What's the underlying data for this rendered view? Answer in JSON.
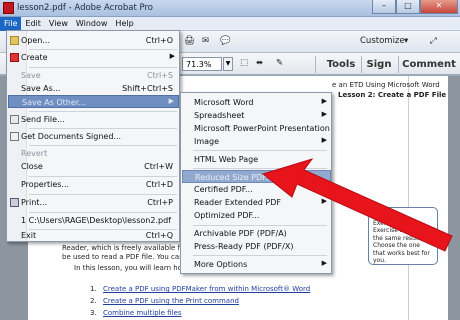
{
  "window": {
    "title": "lesson2.pdf - Adobe Acrobat Pro",
    "min": "–",
    "max": "□",
    "close": "✕"
  },
  "menubar": [
    "File",
    "Edit",
    "View",
    "Window",
    "Help"
  ],
  "toolbar": {
    "customize": "Customize",
    "zoom": "71.3%",
    "tools": "Tools",
    "sign": "Sign",
    "comment": "Comment"
  },
  "file_menu": [
    {
      "label": "Open...",
      "shortcut": "Ctrl+O"
    },
    {
      "label": "Create",
      "shortcut": ""
    },
    {
      "label": "Save",
      "shortcut": "Ctrl+S"
    },
    {
      "label": "Save As...",
      "shortcut": "Shift+Ctrl+S"
    },
    {
      "label": "Save As Other...",
      "shortcut": ""
    },
    {
      "label": "Send File...",
      "shortcut": ""
    },
    {
      "label": "Get Documents Signed...",
      "shortcut": ""
    },
    {
      "label": "Revert",
      "shortcut": ""
    },
    {
      "label": "Close",
      "shortcut": "Ctrl+W"
    },
    {
      "label": "Properties...",
      "shortcut": "Ctrl+D"
    },
    {
      "label": "Print...",
      "shortcut": "Ctrl+P"
    },
    {
      "label": "1 C:\\Users\\RAGE\\Desktop\\lesson2.pdf",
      "shortcut": ""
    },
    {
      "label": "Exit",
      "shortcut": "Ctrl+Q"
    }
  ],
  "submenu": [
    "Microsoft Word",
    "Spreadsheet",
    "Microsoft PowerPoint Presentation",
    "Image",
    "HTML Web Page",
    "Reduced Size PDF...",
    "Certified PDF...",
    "Reader Extended PDF",
    "Optimized PDF...",
    "Archivable PDF (PDF/A)",
    "Press-Ready PDF (PDF/X)",
    "More Options"
  ],
  "document": {
    "header1": "e an ETD Using Microsoft Word",
    "header2": "Lesson 2: Create a PDF File",
    "para1": "Reader, which is freely available for download",
    "para2": "be used to read a PDF file. You cannot",
    "para3": "In this lesson, you will learn how to c",
    "links": [
      "Create a PDF using PDFMaker from within Microsoft® Word",
      "Create a PDF using the Print command",
      "Combine multiple files"
    ],
    "callout_title": "Tip",
    "callout": "Exercise 1 and Exercise 2 produce the same result. Choose the one that works best for you."
  }
}
